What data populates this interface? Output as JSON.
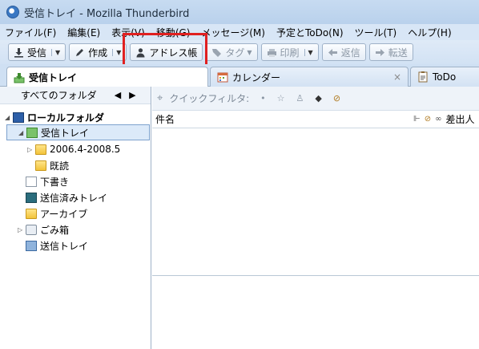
{
  "window": {
    "title": "受信トレイ - Mozilla Thunderbird"
  },
  "menubar": {
    "items": [
      "ファイル(F)",
      "編集(E)",
      "表示(V)",
      "移動(G)",
      "メッセージ(M)",
      "予定とToDo(N)",
      "ツール(T)",
      "ヘルプ(H)"
    ]
  },
  "toolbar": {
    "receive": "受信",
    "compose": "作成",
    "addressbook": "アドレス帳",
    "tag": "タグ",
    "print": "印刷",
    "reply": "返信",
    "forward": "転送"
  },
  "tabs": {
    "inbox": "受信トレイ",
    "calendar": "カレンダー",
    "todo": "ToDo",
    "close_glyph": "×"
  },
  "folderpane": {
    "header": "すべてのフォルダ",
    "local": "ローカルフォルダ",
    "inbox": "受信トレイ",
    "sub1": "2006.4-2008.5",
    "sub2": "既読",
    "drafts": "下書き",
    "sent": "送信済みトレイ",
    "archive": "アーカイブ",
    "trash": "ごみ箱",
    "outbox": "送信トレイ"
  },
  "msgpane": {
    "quickfilter": "クイックフィルタ:",
    "col_subject": "件名",
    "col_from": "差出人"
  }
}
